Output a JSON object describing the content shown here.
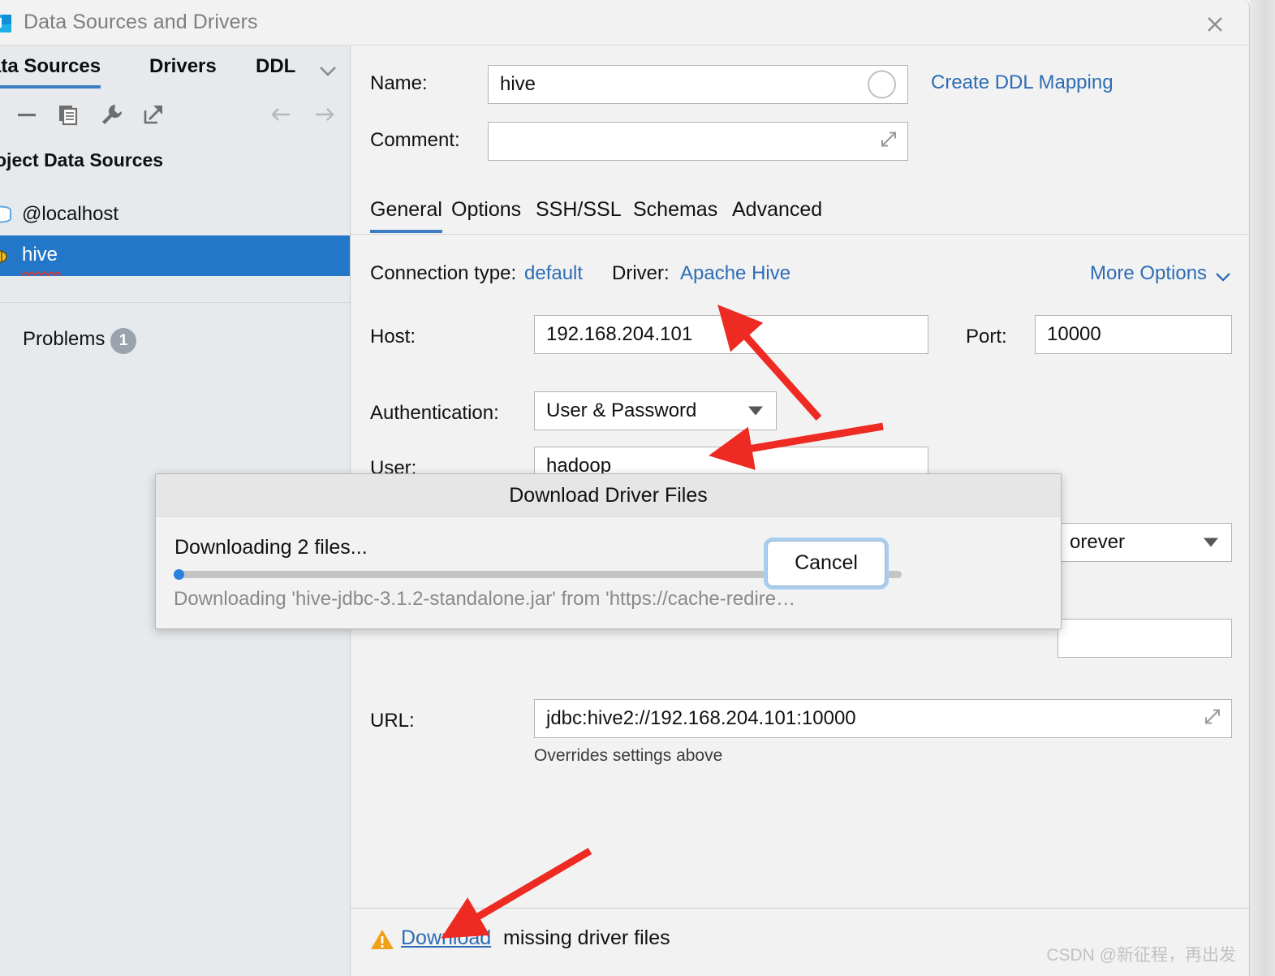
{
  "window": {
    "title": "Data Sources and Drivers",
    "close_icon": "close-icon",
    "app_icon": "datagrip-icon"
  },
  "sidebar": {
    "tabs": [
      {
        "label": "ata Sources",
        "active": true
      },
      {
        "label": "Drivers",
        "active": false
      },
      {
        "label": "DDL",
        "active": false
      }
    ],
    "tabs_overflow_icon": "chevron-down-icon",
    "toolbar_icons": [
      "minus-icon",
      "copy-icon",
      "wrench-icon",
      "export-icon",
      "arrow-left-icon",
      "arrow-right-icon"
    ],
    "group_header": "oject Data Sources",
    "items": [
      {
        "label": "@localhost",
        "icon": "database-icon",
        "selected": false
      },
      {
        "label": "hive",
        "icon": "hive-bee-icon",
        "selected": true,
        "error": true
      }
    ],
    "problems": {
      "label": "Problems",
      "count": "1"
    }
  },
  "general": {
    "name_label": "Name:",
    "name_value": "hive",
    "name_color_swatch": "color-circle-icon",
    "create_ddl_mapping": "Create DDL Mapping",
    "comment_label": "Comment:",
    "comment_value": "",
    "comment_expand_icon": "expand-icon"
  },
  "tabs": [
    {
      "label": "General",
      "active": true
    },
    {
      "label": "Options",
      "active": false
    },
    {
      "label": "SSH/SSL",
      "active": false
    },
    {
      "label": "Schemas",
      "active": false
    },
    {
      "label": "Advanced",
      "active": false
    }
  ],
  "connection": {
    "connection_type_label": "Connection type:",
    "connection_type_value": "default",
    "driver_label": "Driver:",
    "driver_value": "Apache Hive",
    "more_options_label": "More Options",
    "more_options_icon": "chevron-down-icon",
    "host_label": "Host:",
    "host_value": "192.168.204.101",
    "port_label": "Port:",
    "port_value": "10000",
    "auth_label": "Authentication:",
    "auth_value": "User & Password",
    "user_label": "User:",
    "user_value": "hadoop",
    "save_value": "orever",
    "password_value": "",
    "url_label": "URL:",
    "url_value": "jdbc:hive2://192.168.204.101:10000",
    "url_expand_icon": "expand-icon",
    "url_hint": "Overrides settings above"
  },
  "bottom_bar": {
    "warning_icon": "warning-triangle-icon",
    "download_link": "Download",
    "rest_text": "missing driver files"
  },
  "dialog": {
    "title": "Download Driver Files",
    "status": "Downloading 2 files...",
    "detail": "Downloading 'hive-jdbc-3.1.2-standalone.jar' from 'https://cache-redire…",
    "cancel_label": "Cancel",
    "progress_percent": 1
  },
  "watermark": "CSDN @新征程，再出发",
  "colors": {
    "accent": "#2277c8",
    "link": "#2d6cb5",
    "warning": "#f0a11a",
    "annotation_arrow": "#ee2b23"
  }
}
